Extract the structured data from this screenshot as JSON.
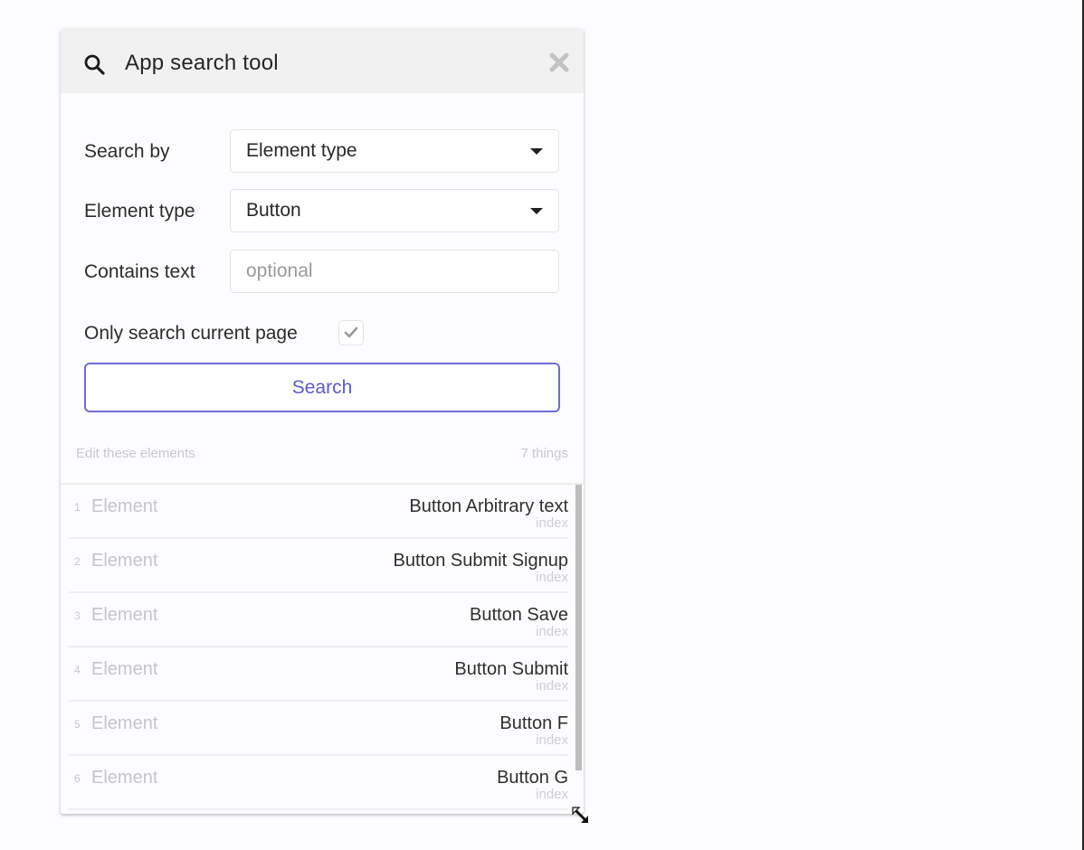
{
  "panel": {
    "title": "App search tool",
    "header_icon": "search-icon",
    "close_icon": "close-icon"
  },
  "form": {
    "search_by": {
      "label": "Search by",
      "value": "Element type"
    },
    "element_type": {
      "label": "Element type",
      "value": "Button"
    },
    "contains_text": {
      "label": "Contains text",
      "value": "",
      "placeholder": "optional"
    },
    "only_current_page": {
      "label": "Only search current page",
      "checked": true
    },
    "search_button_label": "Search"
  },
  "results": {
    "header_label": "Edit these elements",
    "count_label": "7 things",
    "items": [
      {
        "num": "1",
        "kind": "Element",
        "name": "Button Arbitrary text",
        "sub": "index"
      },
      {
        "num": "2",
        "kind": "Element",
        "name": "Button Submit Signup",
        "sub": "index"
      },
      {
        "num": "3",
        "kind": "Element",
        "name": "Button Save",
        "sub": "index"
      },
      {
        "num": "4",
        "kind": "Element",
        "name": "Button Submit",
        "sub": "index"
      },
      {
        "num": "5",
        "kind": "Element",
        "name": "Button F",
        "sub": "index"
      },
      {
        "num": "6",
        "kind": "Element",
        "name": "Button G",
        "sub": "index"
      }
    ]
  },
  "colors": {
    "accent": "#6e6dd6",
    "header_bg": "#f1f1f1",
    "page_bg": "#fcfbfd"
  }
}
